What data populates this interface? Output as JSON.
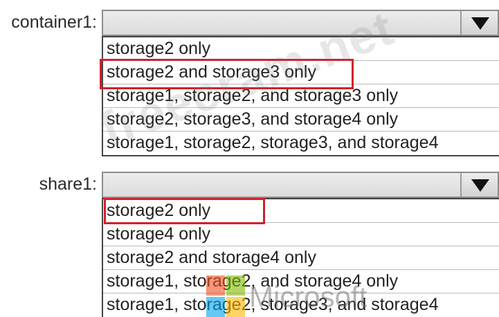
{
  "fields": [
    {
      "id": "container1",
      "label": "container1:",
      "selected_value": "",
      "options": [
        "storage2 only",
        "storage2 and storage3 only",
        "storage1, storage2, and storage3 only",
        "storage2, storage3, and storage4 only",
        "storage1, storage2, storage3, and storage4"
      ],
      "highlighted_option": "storage2 and storage3 only"
    },
    {
      "id": "share1",
      "label": "share1:",
      "selected_value": "",
      "options": [
        "storage2 only",
        "storage4 only",
        "storage2 and storage4 only",
        "storage1, storage2, and storage4 only",
        "storage1, storage2, storage3, and storage4"
      ],
      "highlighted_option": "storage2 only"
    }
  ],
  "watermark": {
    "text": "freecram.net",
    "brand_text": "Microsoft"
  },
  "colors": {
    "highlight": "#d0202a",
    "ms_red": "#f25022",
    "ms_green": "#7fba00",
    "ms_blue": "#00a4ef",
    "ms_yellow": "#ffb900"
  },
  "icons": {
    "dropdown": "triangle-down-icon",
    "brand": "microsoft-logo-icon"
  }
}
